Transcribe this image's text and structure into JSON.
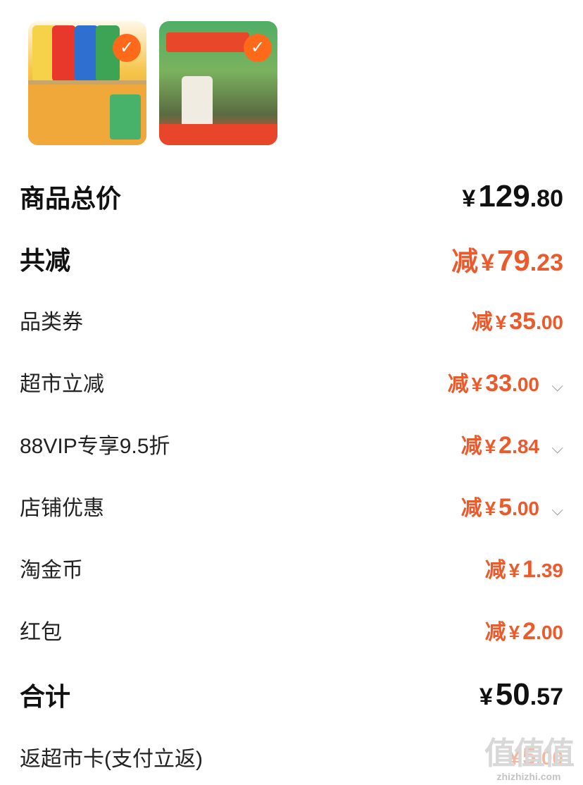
{
  "products": [
    {
      "selected": true,
      "icon": "check-icon"
    },
    {
      "selected": true,
      "icon": "check-icon"
    }
  ],
  "rows": {
    "subtotal": {
      "label": "商品总价",
      "yen": "¥",
      "int": "129",
      "dec": ".80"
    },
    "total_discount": {
      "label": "共减",
      "prefix": "减",
      "yen": "¥",
      "int": "79",
      "dec": ".23"
    },
    "category_coupon": {
      "label": "品类券",
      "prefix": "减",
      "yen": "¥",
      "int": "35",
      "dec": ".00"
    },
    "market_discount": {
      "label": "超市立减",
      "prefix": "减",
      "yen": "¥",
      "int": "33",
      "dec": ".00"
    },
    "vip_discount": {
      "label": "88VIP专享9.5折",
      "prefix": "减",
      "yen": "¥",
      "int": "2",
      "dec": ".84"
    },
    "store_discount": {
      "label": "店铺优惠",
      "prefix": "减",
      "yen": "¥",
      "int": "5",
      "dec": ".00"
    },
    "taojinbi": {
      "label": "淘金币",
      "prefix": "减",
      "yen": "¥",
      "int": "1",
      "dec": ".39"
    },
    "red_packet": {
      "label": "红包",
      "prefix": "减",
      "yen": "¥",
      "int": "2",
      "dec": ".00"
    },
    "total": {
      "label": "合计",
      "yen": "¥",
      "int": "50",
      "dec": ".57"
    },
    "rebate": {
      "label": "返超市卡(支付立返)",
      "yen": "¥",
      "int": "5",
      "dec": ".00"
    }
  },
  "watermark": {
    "big": "值值值",
    "small": "zhizhizhi.com"
  },
  "colors": {
    "accent": "#ec5a2c",
    "check": "#ff6a1a"
  }
}
